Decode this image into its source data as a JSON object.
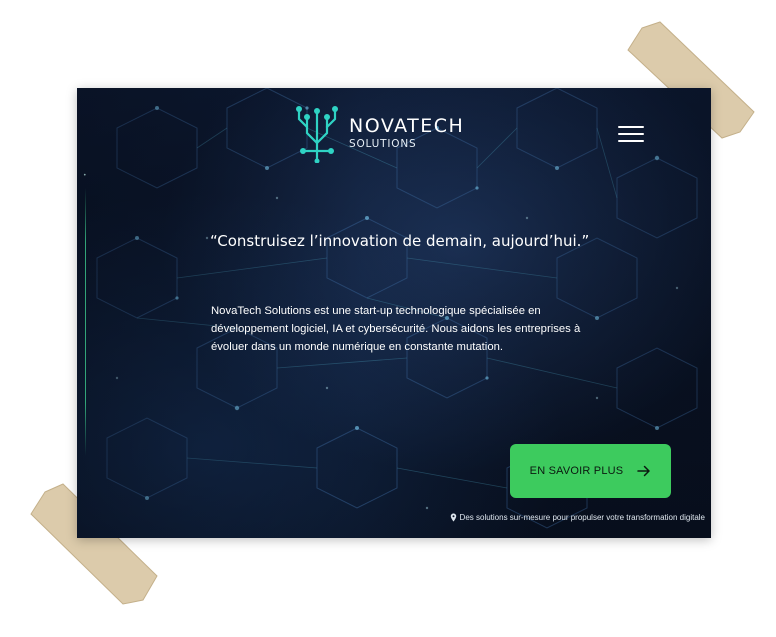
{
  "brand": {
    "name": "NOVATECH",
    "subtitle": "SOLUTIONS"
  },
  "header": {
    "menu_icon": "hamburger-menu-icon"
  },
  "hero": {
    "quote": "“Construisez l’innovation de demain, aujourd’hui.”",
    "description": "NovaTech Solutions est une start-up technologique spécialisée en développement logiciel, IA et cybersécurité. Nous aidons les entreprises à évoluer dans un monde numérique en constante mutation.",
    "cta_label": "EN SAVOIR PLUS",
    "cta_icon": "arrow-right-icon"
  },
  "footer_note": {
    "icon": "pin-icon",
    "text": "Des solutions sur-mesure pour propulser votre transformation digitale"
  },
  "colors": {
    "accent": "#3dcb5e",
    "logo_teal": "#2fd3c4",
    "background": "#0a1427",
    "tape": "#d6c3a0"
  }
}
